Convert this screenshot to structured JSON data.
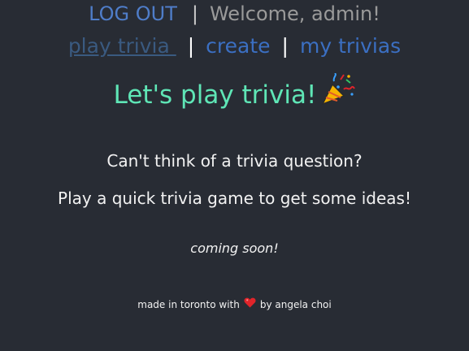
{
  "header": {
    "logout_label": "LOG OUT",
    "separator": "|",
    "welcome_text": "Welcome, admin!"
  },
  "nav": {
    "items": [
      {
        "label": "play trivia ",
        "active": true
      },
      {
        "label": "create",
        "active": false
      },
      {
        "label": "my trivias",
        "active": false
      }
    ],
    "separator": "|"
  },
  "main": {
    "headline": "Let's play trivia!",
    "headline_icon": "party-popper-icon",
    "line1": "Can't think of a trivia question?",
    "line2": "Play a quick trivia game to get some ideas!",
    "status": "coming soon!"
  },
  "footer": {
    "prefix": "made in toronto with",
    "icon": "heart-icon",
    "suffix": "by angela choi"
  },
  "colors": {
    "background": "#282c34",
    "logout": "#4f7dc9",
    "nav_link": "#3b6fc2",
    "headline": "#5fe6b6",
    "heart": "#e0242a"
  }
}
